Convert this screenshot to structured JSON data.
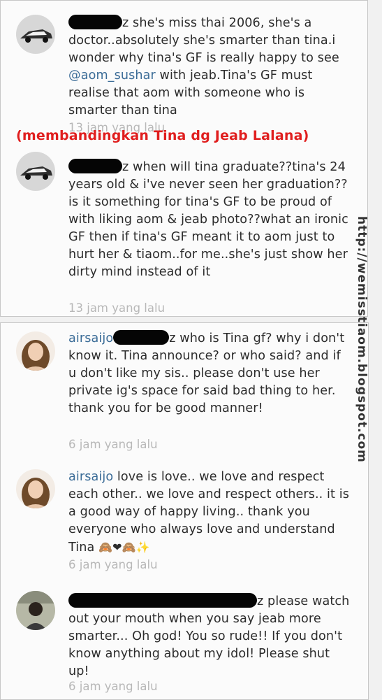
{
  "comments": [
    {
      "username_suffix": "z",
      "text": "she's miss thai 2006, she's a doctor..absolutely she's smarter than tina.i wonder why tina's GF is really happy to see ",
      "mention": "@aom_sushar",
      "text_after": " with jeab.Tina's GF must realise that aom with someone who is smarter than tina",
      "time": "13 jam yang lalu"
    },
    {
      "username_suffix": "z",
      "text": "when will tina graduate??tina's 24 years old & i've never seen her graduation??is it something for tina's GF to be proud of with liking aom & jeab photo??what an ironic GF then if tina's GF meant it to aom just to hurt her & tiaom..for me..she's just show her dirty mind instead of it",
      "time": "13 jam yang lalu"
    },
    {
      "username": "airsaijo",
      "username_suffix": "z",
      "text": "who is Tina gf? why i don't know it. Tina announce? or who said? and if u don't like my sis.. please don't use her private ig's space for said bad thing to her. thank you for be good manner!",
      "time": "6 jam yang lalu"
    },
    {
      "username": "airsaijo",
      "text": "love is love.. we love and respect each other.. we love and respect others.. it is a good way of happy living.. thank you everyone who always love and understand Tina",
      "emoji": "🙈❤🙈✨",
      "time": "6 jam yang lalu"
    },
    {
      "username_suffix": "z",
      "text": "please watch out your mouth when you say jeab more smarter... Oh god! You so rude!! If you don't know anything about my idol! Please shut up!",
      "time": "6 jam yang lalu"
    }
  ],
  "overlay_caption": "(membandingkan Tina dg Jeab Lalana)",
  "watermark": "http://wemisstiaom.blogspot.com",
  "colors": {
    "username": "#3b6c97",
    "caption": "#e01e1e",
    "time": "#b8b8b8"
  }
}
